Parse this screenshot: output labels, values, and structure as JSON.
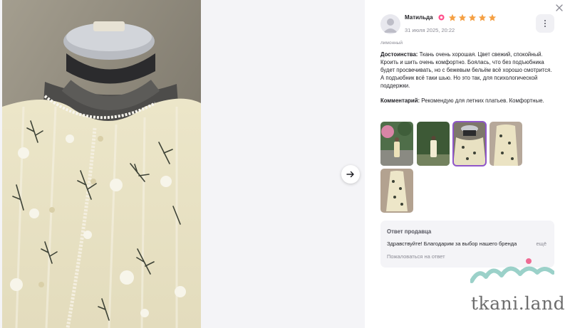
{
  "review": {
    "author": "Матильда",
    "rating": 5,
    "rating_max": 5,
    "date": "31 июля 2025, 20:22",
    "variant": "лимонный",
    "pros_label": "Достоинства:",
    "pros_text": "Ткань очень хорошая. Цвет свежий, спокойный. Кроить и шить очень комфортно. Боялась, что без подъюбника будет просвечивать, но с бежевым бельём всё хорошо смотрится. А подъюбник всё таки шью. Но это так, для психологической поддержки.",
    "comment_label": "Комментарий:",
    "comment_text": "Рекомендую для летних платьев. Комфортные.",
    "photos_count": 5,
    "active_photo": 3
  },
  "seller": {
    "title": "Ответ продавца",
    "text": "Здравствуйте! Благодарим за выбор нашего бренда",
    "more": "ещё",
    "complain": "Пожаловаться на ответ"
  },
  "watermark": "tkani.land",
  "colors": {
    "star": "#f5a043",
    "accent": "#8f56c9",
    "badge": "#ff4f8b",
    "watermark": "#6d6d6d",
    "watermark_mark": "#8ac9bf"
  },
  "icons": [
    "close-icon",
    "arrow-right-icon",
    "more-vertical-icon",
    "verified-badge-icon",
    "star-icon",
    "user-avatar-icon"
  ]
}
